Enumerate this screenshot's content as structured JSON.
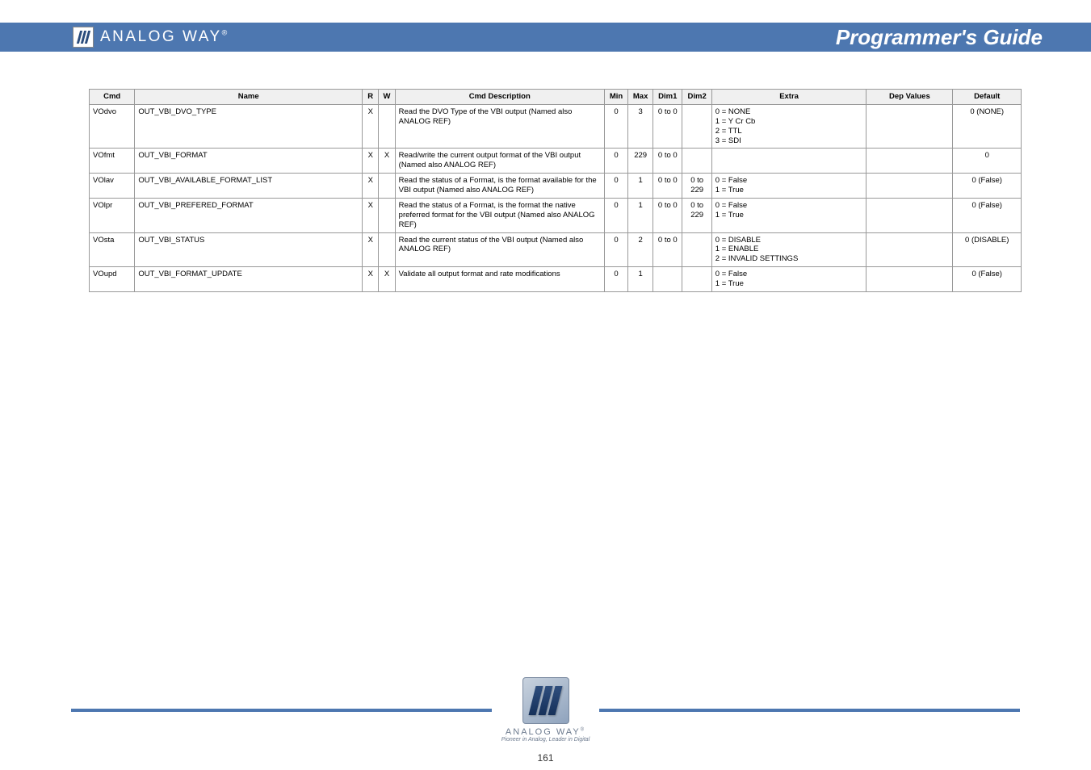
{
  "header": {
    "brand": "ANALOG WAY",
    "brand_sup": "®",
    "title": "Programmer's Guide"
  },
  "table": {
    "headers": [
      "Cmd",
      "Name",
      "R",
      "W",
      "Cmd Description",
      "Min",
      "Max",
      "Dim1",
      "Dim2",
      "Extra",
      "Dep Values",
      "Default"
    ],
    "rows": [
      {
        "cmd": "VOdvo",
        "name": "OUT_VBI_DVO_TYPE",
        "r": "X",
        "w": "",
        "desc": "Read the DVO Type of the VBI output (Named also ANALOG REF)",
        "min": "0",
        "max": "3",
        "d1": "0 to 0",
        "d2": "",
        "extra": "0 = NONE\n1 = Y Cr Cb\n2 = TTL\n3 = SDI",
        "dv": "",
        "def": "0 (NONE)"
      },
      {
        "cmd": "VOfmt",
        "name": "OUT_VBI_FORMAT",
        "r": "X",
        "w": "X",
        "desc": "Read/write the current output format of the VBI output (Named also ANALOG REF)",
        "min": "0",
        "max": "229",
        "d1": "0 to 0",
        "d2": "",
        "extra": "",
        "dv": "",
        "def": "0"
      },
      {
        "cmd": "VOlav",
        "name": "OUT_VBI_AVAILABLE_FORMAT_LIST",
        "r": "X",
        "w": "",
        "desc": "Read the status of a Format, is the format available for the VBI output (Named also ANALOG REF)",
        "min": "0",
        "max": "1",
        "d1": "0 to 0",
        "d2": "0 to 229",
        "extra": "0 = False\n1 = True",
        "dv": "",
        "def": "0 (False)"
      },
      {
        "cmd": "VOlpr",
        "name": "OUT_VBI_PREFERED_FORMAT",
        "r": "X",
        "w": "",
        "desc": "Read the status of a Format, is the format the native preferred format for the VBI output (Named also ANALOG REF)",
        "min": "0",
        "max": "1",
        "d1": "0 to 0",
        "d2": "0 to 229",
        "extra": "0 = False\n1 = True",
        "dv": "",
        "def": "0 (False)"
      },
      {
        "cmd": "VOsta",
        "name": "OUT_VBI_STATUS",
        "r": "X",
        "w": "",
        "desc": "Read the current status of the VBI output (Named also ANALOG REF)",
        "min": "0",
        "max": "2",
        "d1": "0 to 0",
        "d2": "",
        "extra": "0 = DISABLE\n1 = ENABLE\n2 = INVALID SETTINGS",
        "dv": "",
        "def": "0 (DISABLE)"
      },
      {
        "cmd": "VOupd",
        "name": "OUT_VBI_FORMAT_UPDATE",
        "r": "X",
        "w": "X",
        "desc": "Validate all output format and rate modifications",
        "min": "0",
        "max": "1",
        "d1": "",
        "d2": "",
        "extra": "0 = False\n1 = True",
        "dv": "",
        "def": "0 (False)"
      }
    ]
  },
  "footer": {
    "brand": "ANALOG WAY",
    "brand_sup": "®",
    "tagline": "Pioneer in Analog, Leader in Digital",
    "page": "161"
  }
}
